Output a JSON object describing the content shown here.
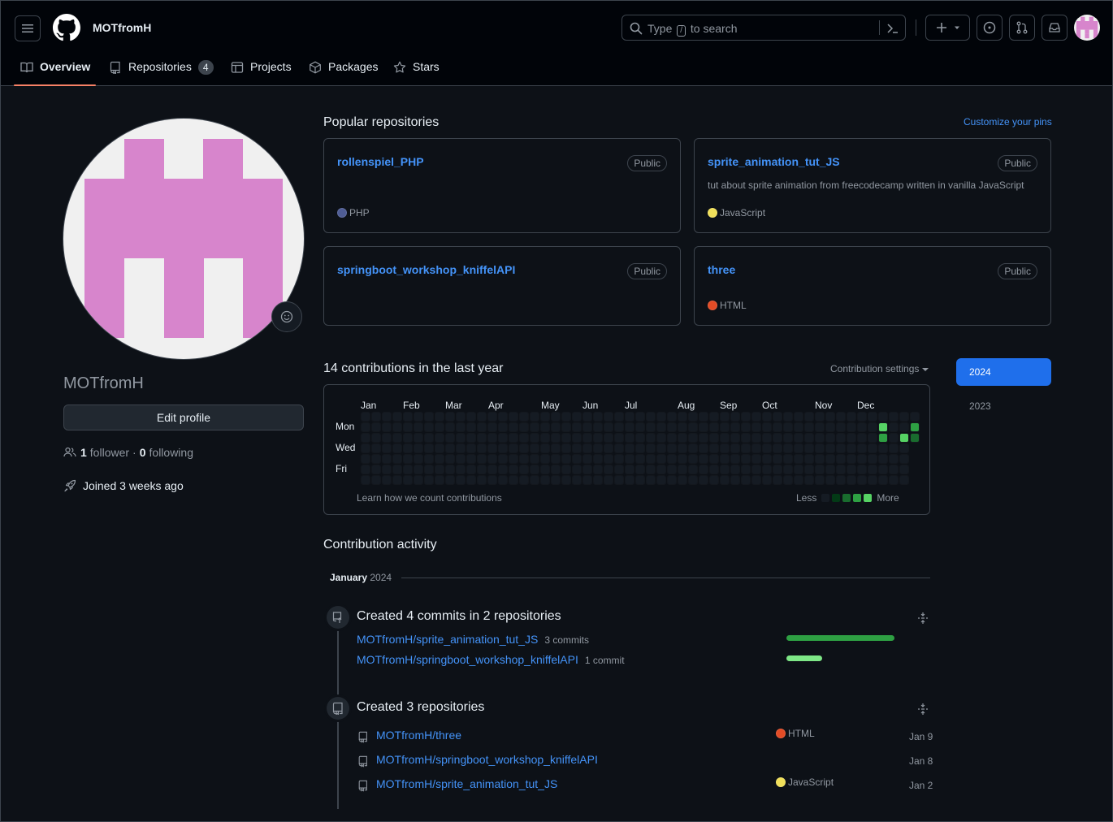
{
  "header": {
    "username": "MOTfromH",
    "search": {
      "before": "Type",
      "key": "/",
      "after": "to search"
    }
  },
  "tabs": [
    {
      "label": "Overview",
      "icon": "book-icon",
      "active": true
    },
    {
      "label": "Repositories",
      "icon": "repo-icon",
      "count": "4"
    },
    {
      "label": "Projects",
      "icon": "table-icon"
    },
    {
      "label": "Packages",
      "icon": "package-icon"
    },
    {
      "label": "Stars",
      "icon": "star-icon"
    }
  ],
  "profile": {
    "name": "MOTfromH",
    "edit_label": "Edit profile",
    "followers_count": "1",
    "followers_label": "follower",
    "following_count": "0",
    "following_label": "following",
    "separator": "·",
    "joined": "Joined 3 weeks ago"
  },
  "popular": {
    "title": "Popular repositories",
    "customize": "Customize your pins",
    "repos": [
      {
        "name": "rollenspiel_PHP",
        "visibility": "Public",
        "description": "",
        "language": "PHP",
        "color": "#4F5D95"
      },
      {
        "name": "sprite_animation_tut_JS",
        "visibility": "Public",
        "description": "tut about sprite animation from freecodecamp written in vanilla JavaScript",
        "language": "JavaScript",
        "color": "#f1e05a"
      },
      {
        "name": "springboot_workshop_kniffelAPI",
        "visibility": "Public",
        "description": "",
        "language": "",
        "color": ""
      },
      {
        "name": "three",
        "visibility": "Public",
        "description": "",
        "language": "HTML",
        "color": "#e34c26"
      }
    ]
  },
  "contributions": {
    "title": "14 contributions in the last year",
    "settings": "Contribution settings",
    "months": [
      "Jan",
      "Feb",
      "Mar",
      "Apr",
      "May",
      "Jun",
      "Jul",
      "Aug",
      "Sep",
      "Oct",
      "Nov",
      "Dec"
    ],
    "days": [
      "Mon",
      "Wed",
      "Fri"
    ],
    "learn": "Learn how we count contributions",
    "less": "Less",
    "more": "More",
    "level_colors": [
      "#151b23",
      "#033a16",
      "#196c2e",
      "#2ea043",
      "#56d364"
    ],
    "active_cells": [
      {
        "week": 49,
        "day": 1,
        "level": 4
      },
      {
        "week": 49,
        "day": 2,
        "level": 3
      },
      {
        "week": 51,
        "day": 2,
        "level": 4
      },
      {
        "week": 52,
        "day": 1,
        "level": 3
      },
      {
        "week": 52,
        "day": 2,
        "level": 2
      }
    ],
    "years": [
      "2024",
      "2023"
    ]
  },
  "activity": {
    "title": "Contribution activity",
    "month": "January",
    "year": "2024",
    "commits": {
      "title": "Created 4 commits in 2 repositories",
      "items": [
        {
          "repo": "MOTfromH/sprite_animation_tut_JS",
          "count": "3 commits",
          "share": 1.0,
          "color": "#2ea043"
        },
        {
          "repo": "MOTfromH/springboot_workshop_kniffelAPI",
          "count": "1 commit",
          "share": 0.33,
          "color": "#7ee787"
        }
      ]
    },
    "repos": {
      "title": "Created 3 repositories",
      "items": [
        {
          "repo": "MOTfromH/three",
          "language": "HTML",
          "color": "#e34c26",
          "date": "Jan 9"
        },
        {
          "repo": "MOTfromH/springboot_workshop_kniffelAPI",
          "language": "",
          "color": "",
          "date": "Jan 8"
        },
        {
          "repo": "MOTfromH/sprite_animation_tut_JS",
          "language": "JavaScript",
          "color": "#f1e05a",
          "date": "Jan 2"
        }
      ]
    }
  }
}
